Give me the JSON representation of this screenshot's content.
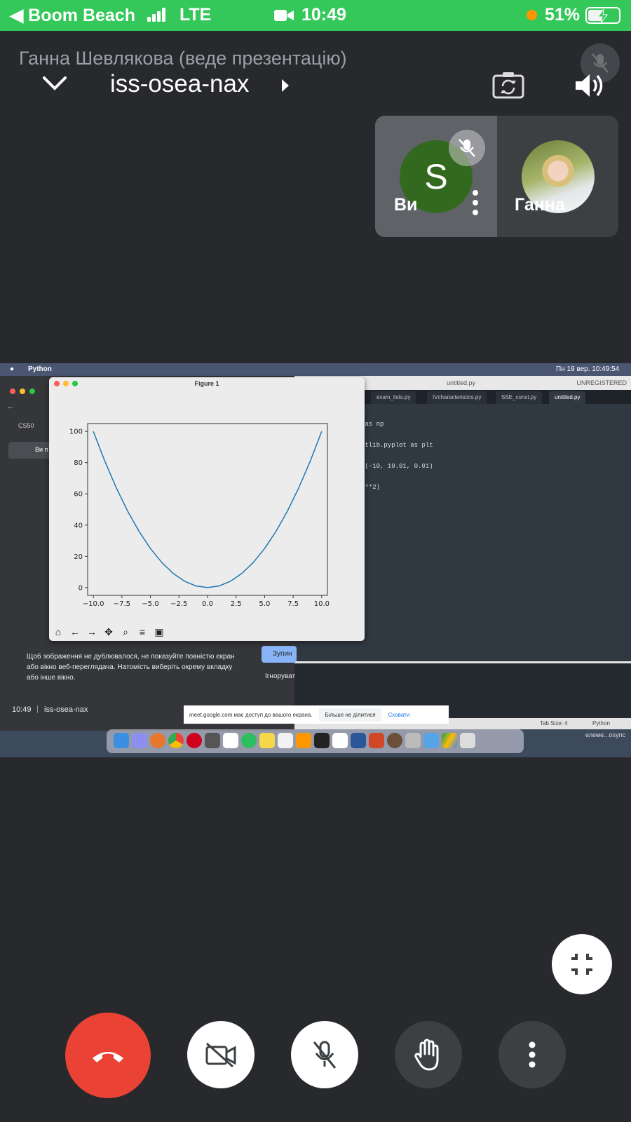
{
  "status_bar": {
    "back_app": "◀ Boom Beach",
    "network": "LTE",
    "time": "10:49",
    "battery_percent": "51%",
    "battery_level": 0.51,
    "bar_color": "#34c759"
  },
  "call": {
    "presenter_label": "Ганна Шевлякова (веде презентацію)",
    "meeting_code": "iss-osea-nax"
  },
  "tiles": {
    "me": {
      "initial": "S",
      "name": "Ви"
    },
    "other": {
      "name": "Ганна"
    }
  },
  "shared_screen": {
    "menubar": {
      "app": "Python",
      "date_time": "Пн 19 вер.  10:49:54"
    },
    "sublime": {
      "title": "untitled.py",
      "registration": "UNREGISTERED",
      "tabs": [
        "exam_lists.py",
        "IVcharacteristics.py",
        "SSE_const.py",
        "untitled.py"
      ],
      "code_lines": [
        " as np",
        "otlib.pyplot as plt",
        "e(-10, 10.01, 0.01)",
        "x**2)"
      ],
      "status_tab_size": "Tab Size: 4",
      "status_syntax": "Python"
    },
    "figure": {
      "title": "Figure 1",
      "toolbar_icons": [
        "home-icon",
        "back-arrow-icon",
        "forward-arrow-icon",
        "pan-icon",
        "zoom-icon",
        "configure-icon",
        "save-icon"
      ]
    },
    "browser": {
      "bookmark": "CS50",
      "share_button_partial": "Ви п",
      "tip_text": "Щоб зображення не дублювалося, не показуйте повністю екран або вікно веб-переглядача. Натомість виберіть окрему вкладку або інше вікно.",
      "stop_button_partial": "Зупин",
      "ignore_partial": "Ігноруват",
      "footer_time": "10:49",
      "footer_code": "iss-osea-nax"
    },
    "notice": {
      "text": "meet.google.com має доступ до вашого екрана.",
      "stop_sharing": "Більше не ділитися",
      "hide": "Сховати"
    },
    "dock_right_text": "елеме...osync"
  },
  "chart_data": {
    "type": "line",
    "title": "",
    "xlabel": "",
    "ylabel": "",
    "xlim": [
      -10.5,
      10.5
    ],
    "ylim": [
      -5,
      105
    ],
    "x_ticks": [
      -10.0,
      -7.5,
      -5.0,
      -2.5,
      0.0,
      2.5,
      5.0,
      7.5,
      10.0
    ],
    "x_tick_labels": [
      "−10.0",
      "−7.5",
      "−5.0",
      "−2.5",
      "0.0",
      "2.5",
      "5.0",
      "7.5",
      "10.0"
    ],
    "y_ticks": [
      0,
      20,
      40,
      60,
      80,
      100
    ],
    "y_tick_labels": [
      "0",
      "20",
      "40",
      "60",
      "80",
      "100"
    ],
    "series": [
      {
        "color": "#1f77b4",
        "x": [
          -10,
          -9,
          -8,
          -7,
          -6,
          -5,
          -4,
          -3,
          -2,
          -1,
          0,
          1,
          2,
          3,
          4,
          5,
          6,
          7,
          8,
          9,
          10
        ],
        "y": [
          100,
          81,
          64,
          49,
          36,
          25,
          16,
          9,
          4,
          1,
          0,
          1,
          4,
          9,
          16,
          25,
          36,
          49,
          64,
          81,
          100
        ]
      }
    ],
    "grid": false
  }
}
